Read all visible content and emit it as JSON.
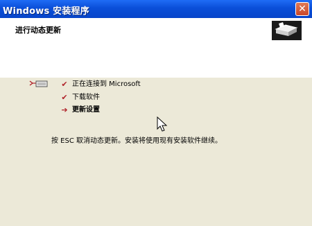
{
  "window": {
    "title": "Windows 安装程序",
    "close_label": "✕"
  },
  "header": {
    "title": "进行动态更新"
  },
  "steps": [
    {
      "label": "正在连接到 Microsoft",
      "status": "done",
      "marker": "✔"
    },
    {
      "label": "下载软件",
      "status": "done",
      "marker": "✔"
    },
    {
      "label": "更新设置",
      "status": "current",
      "marker": "➔"
    }
  ],
  "note": "按 ESC 取消动态更新。安装将使用现有安装软件继续。",
  "icons": {
    "network": "network-connect-icon",
    "setup_logo": "setup-logo-icon",
    "cursor": "mouse-cursor-icon"
  },
  "colors": {
    "title_bar": "#0a4ed8",
    "body_bg": "#ece9d8",
    "check": "#b0232a"
  }
}
